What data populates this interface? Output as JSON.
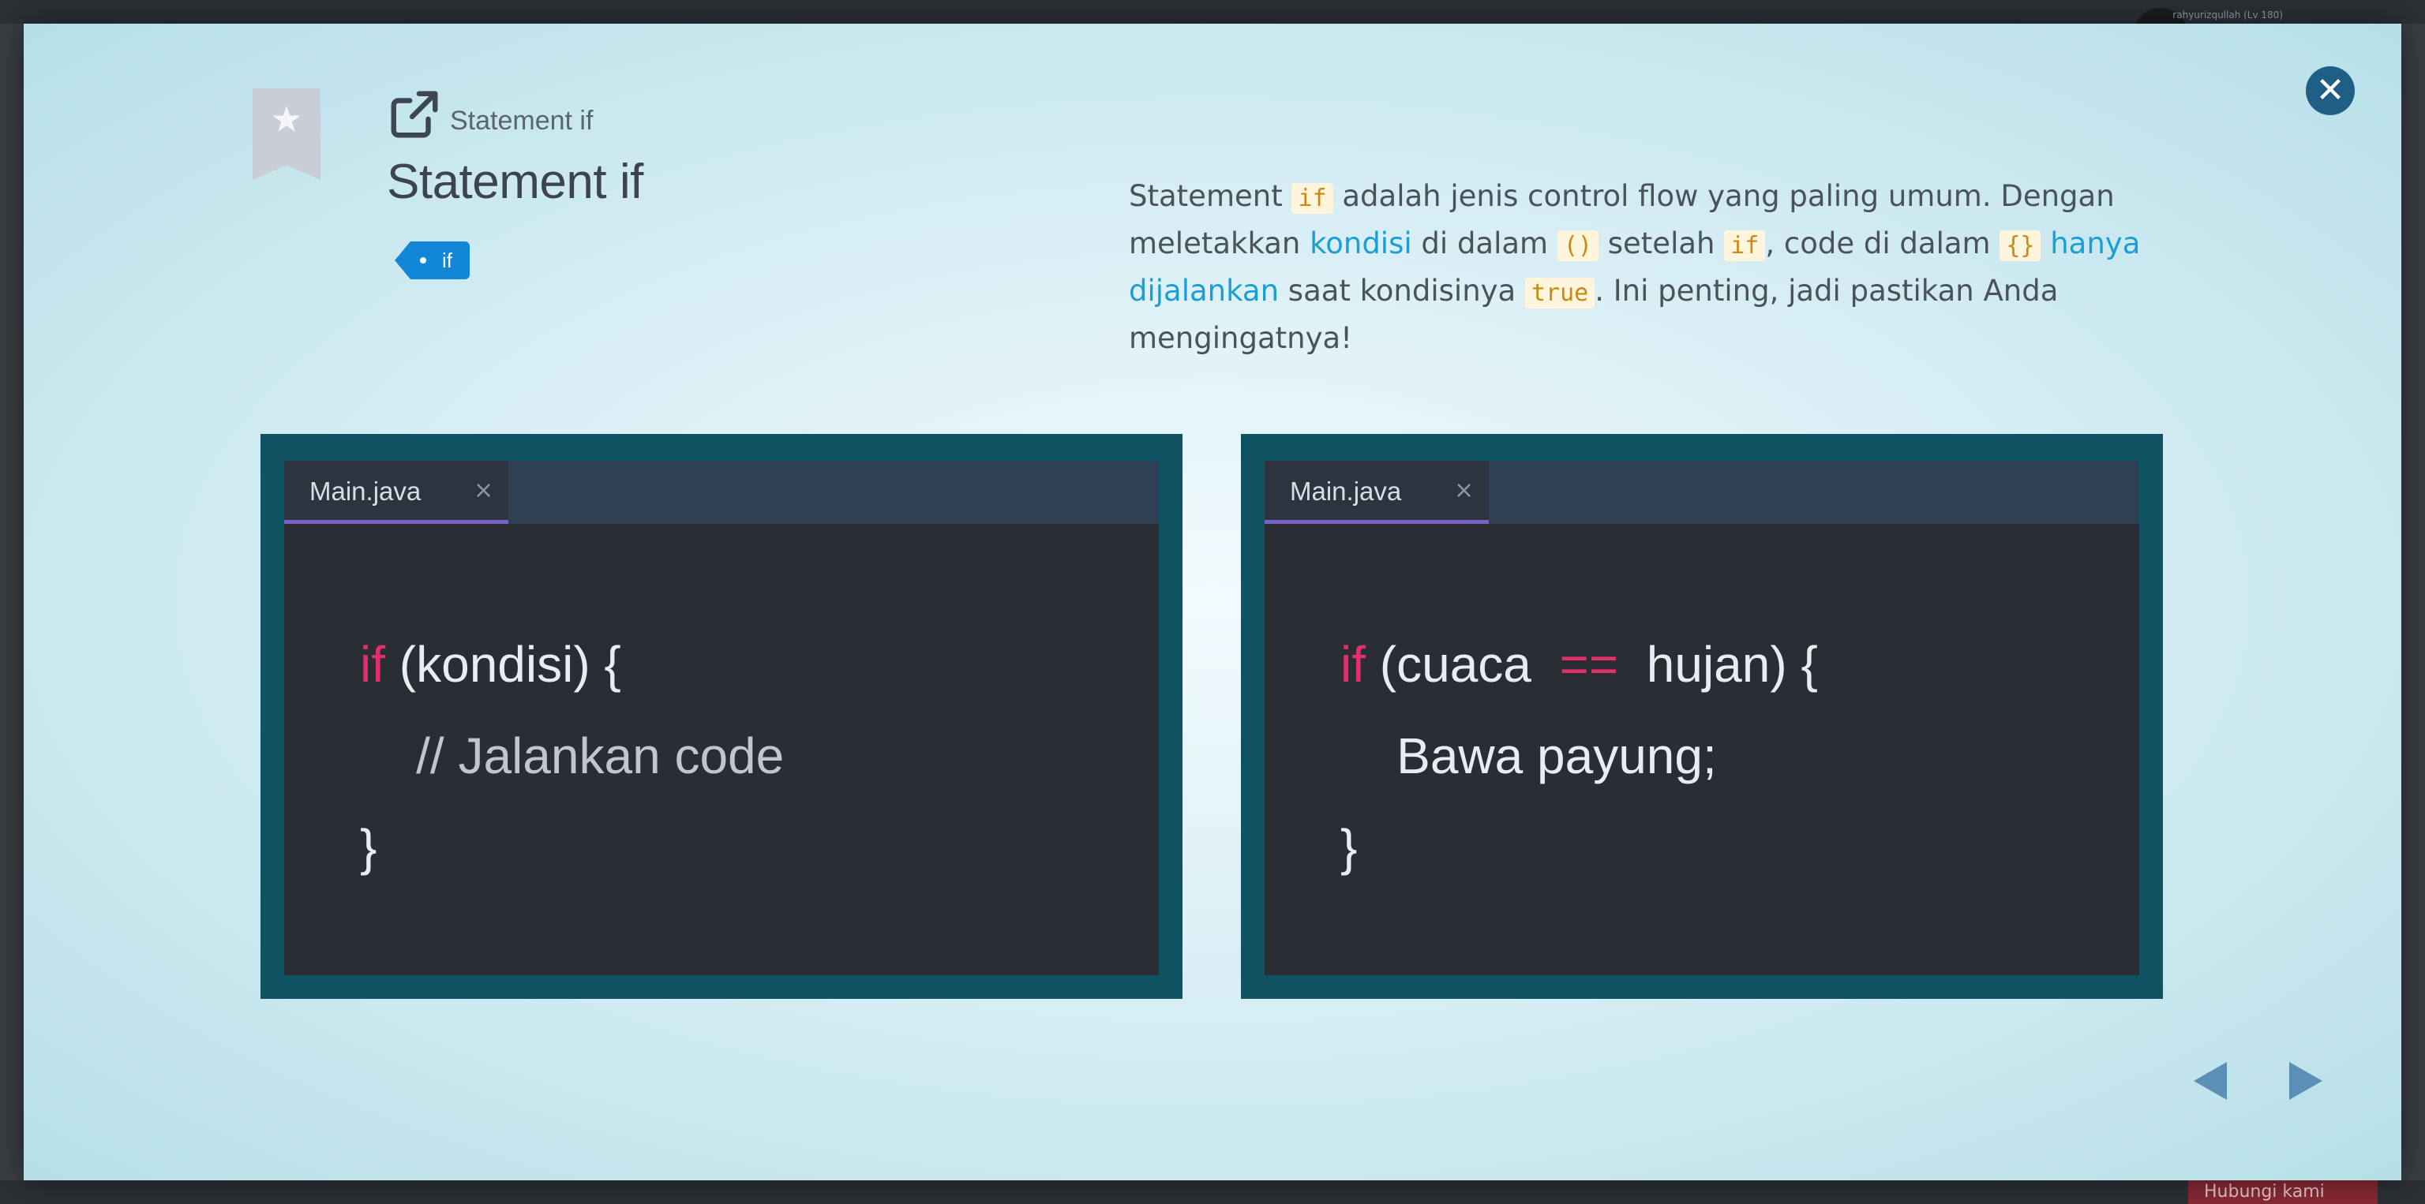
{
  "backdrop": {
    "user_text": "rahyurizqullah (Lv 180)",
    "help_button": "Hubungi kami"
  },
  "modal": {
    "breadcrumb": "Statement if",
    "title": "Statement if",
    "tag": "if",
    "description": {
      "p1": "Statement ",
      "code_if_1": "if",
      "p2": " adalah jenis control flow yang paling umum. Dengan meletakkan ",
      "hl_kondisi": "kondisi",
      "p3": " di dalam ",
      "code_parens": "()",
      "p4": " setelah ",
      "code_if_2": "if",
      "p5": ", code di dalam ",
      "code_braces": "{}",
      "p6": " ",
      "hl_hanya": "hanya dijalankan",
      "p7": " saat kondisinya ",
      "code_true": "true",
      "p8": ". Ini penting, jadi pastikan Anda mengingatnya!"
    },
    "editor_left": {
      "tab_name": "Main.java",
      "tab_close": "×",
      "kw_if": "if",
      "line1_rest": " (kondisi) {",
      "line2": "    // Jalankan code",
      "line3": "}"
    },
    "editor_right": {
      "tab_name": "Main.java",
      "tab_close": "×",
      "kw_if": "if",
      "line1_mid": " (cuaca  ",
      "op_eq": "==",
      "line1_rest": "  hujan) {",
      "line2": "    Bawa payung;",
      "line3": "}"
    },
    "icons": {
      "bookmark": "bookmark-star-icon",
      "external": "external-link-icon",
      "close": "close-icon",
      "prev": "prev-arrow-icon",
      "next": "next-arrow-icon"
    }
  }
}
